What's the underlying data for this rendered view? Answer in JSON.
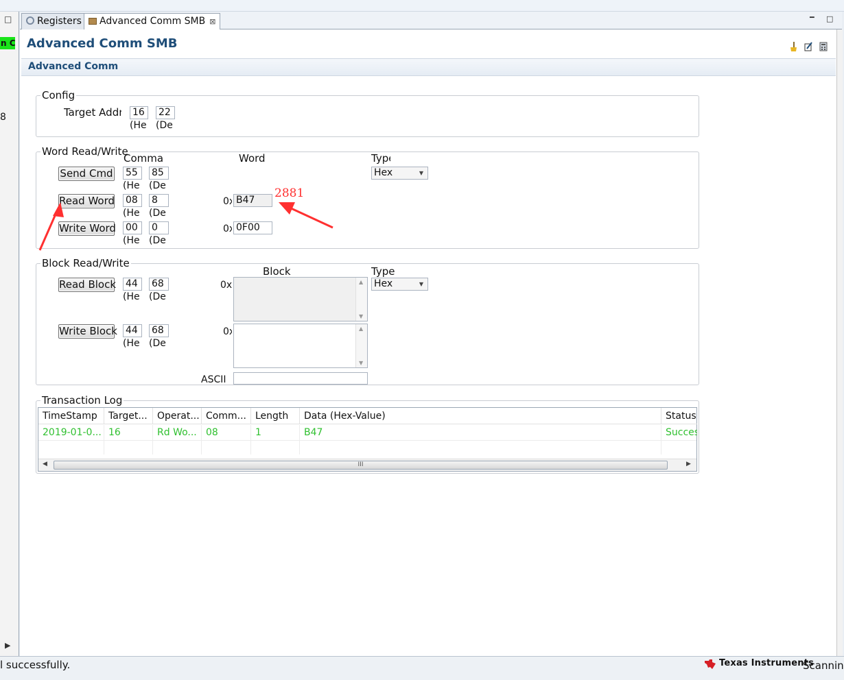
{
  "left_panel": {
    "badge": "n C",
    "value": "8"
  },
  "tabs": [
    {
      "label": "Registers",
      "icon": "gear-icon"
    },
    {
      "label": "Advanced Comm SMB",
      "icon": "package-icon",
      "close": "⊠"
    }
  ],
  "page": {
    "title": "Advanced Comm SMB",
    "section": "Advanced Comm"
  },
  "config": {
    "group_label": "Config",
    "target_label": "Target Addr",
    "target_hex": "16",
    "target_dec": "22",
    "hex_caption": "(He",
    "dec_caption": "(De"
  },
  "word_rw": {
    "group_label": "Word Read/Write",
    "col_command": "Commar",
    "col_word": "Word",
    "col_type": "Type",
    "type_value": "Hex",
    "prefix": "0x",
    "rows": [
      {
        "button": "Send Cmd",
        "hex": "55",
        "dec": "85",
        "word": ""
      },
      {
        "button": "Read Word",
        "hex": "08",
        "dec": "8",
        "word": "B47"
      },
      {
        "button": "Write Word",
        "hex": "00",
        "dec": "0",
        "word": "0F00"
      }
    ]
  },
  "annotation": {
    "text": "2881",
    "color": "#ff3030"
  },
  "block_rw": {
    "group_label": "Block Read/Write",
    "col_block": "Block",
    "col_type": "Type",
    "type_value": "Hex",
    "prefix": "0x",
    "ascii_label": "ASCII",
    "read_button": "Read Block",
    "read_hex": "44",
    "read_dec": "68",
    "write_button": "Write Block",
    "write_hex": "44",
    "write_dec": "68"
  },
  "log": {
    "group_label": "Transaction Log",
    "columns": [
      "TimeStamp",
      "Target...",
      "Operat...",
      "Comm...",
      "Length",
      "Data (Hex-Value)",
      "Status"
    ],
    "rows": [
      [
        "2019-01-0...",
        "16",
        "Rd Wo...",
        "08",
        "1",
        "B47",
        "Succes"
      ]
    ],
    "scroll_grip": "III"
  },
  "status": {
    "message": "l successfully.",
    "vendor": "Texas Instruments",
    "right": "Scanning"
  }
}
